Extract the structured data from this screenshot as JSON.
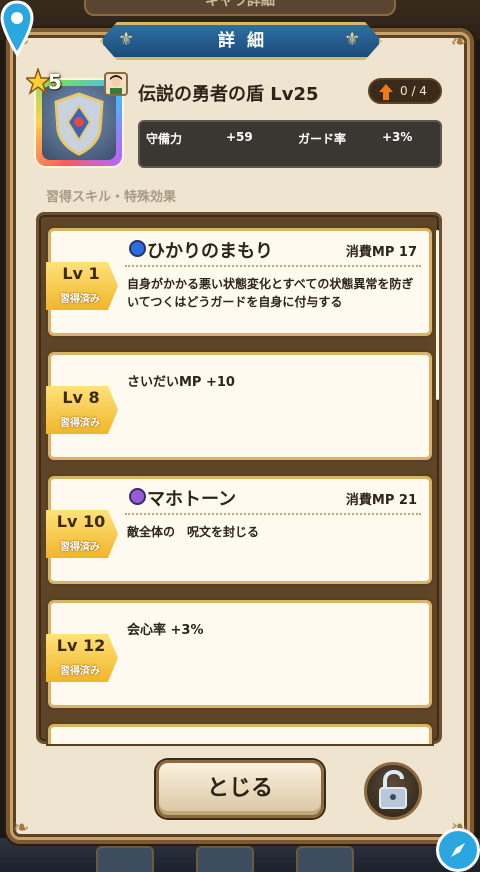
{
  "background": {
    "top_title": "ギャラ詳細"
  },
  "dialog": {
    "title": "詳細"
  },
  "item": {
    "stars": "5",
    "name": "伝説の勇者の盾 Lv25",
    "stock": "0 / 4",
    "stats": [
      {
        "label": "守備力",
        "value": "+59"
      },
      {
        "label": "ガード率",
        "value": "+3%"
      }
    ]
  },
  "section_label": "習得スキル・特殊効果",
  "skills": [
    {
      "lv": "Lv 1",
      "status": "習得済み",
      "name": "ひかりのまもり",
      "mp": "消費MP 17",
      "desc": "自身がかかる悪い状態変化とすべての状態異常を防ぎ　いてつくはどうガードを自身に付与する",
      "orb_color": "#2a6ee0"
    },
    {
      "lv": "Lv 8",
      "status": "習得済み",
      "desc": "さいだいMP +10"
    },
    {
      "lv": "Lv 10",
      "status": "習得済み",
      "name": "マホトーン",
      "mp": "消費MP 21",
      "desc": "敵全体の　呪文を封じる",
      "orb_color": "#9a5ad8"
    },
    {
      "lv": "Lv 12",
      "status": "習得済み",
      "desc": "会心率 +3%"
    }
  ],
  "buttons": {
    "close": "とじる"
  },
  "icons": {
    "location": "location-pin-icon",
    "lock": "unlock-icon",
    "compass": "compass-icon",
    "upgrade": "upgrade-arrow-icon"
  },
  "colors": {
    "panel": "#efe4d0",
    "banner": "#2f6ea4",
    "gold": "#f0b62a",
    "frame": "#7b5a33"
  }
}
